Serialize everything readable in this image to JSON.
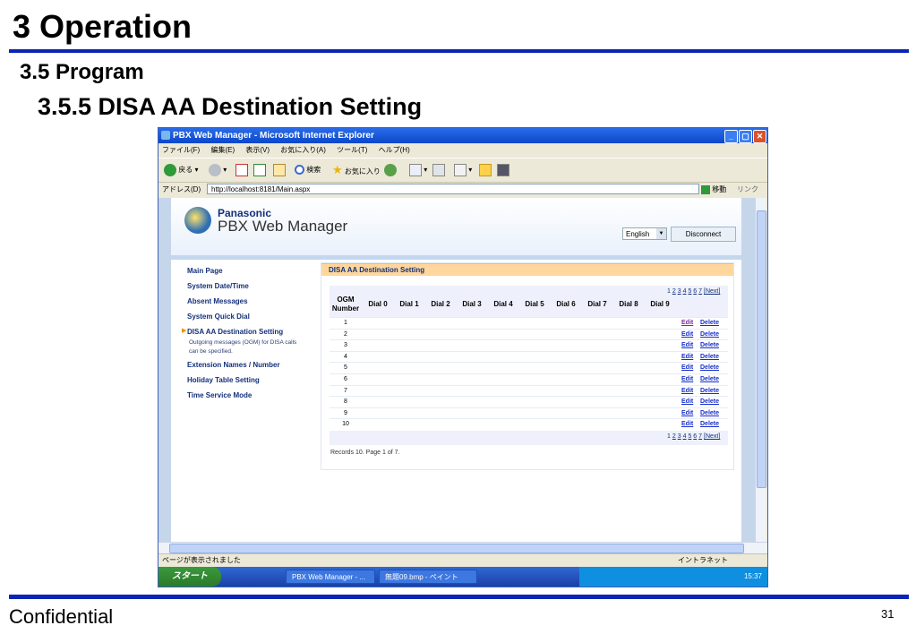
{
  "slide": {
    "title": "3 Operation",
    "subtitle1": "3.5 Program",
    "subtitle2": "3.5.5 DISA AA Destination Setting",
    "footer_left": "Confidential",
    "page_number": "31"
  },
  "browser": {
    "window_title": "PBX Web Manager - Microsoft Internet Explorer",
    "menu": [
      "ファイル(F)",
      "編集(E)",
      "表示(V)",
      "お気に入り(A)",
      "ツール(T)",
      "ヘルプ(H)"
    ],
    "toolbar": {
      "back": "戻る",
      "search": "検索",
      "favorites": "お気に入り"
    },
    "address_label": "アドレス(D)",
    "url": "http://localhost:8181/Main.aspx",
    "go_label": "移動",
    "links_label": "リンク",
    "status_left": "ページが表示されました",
    "status_right": "イントラネット"
  },
  "taskbar": {
    "start": "スタート",
    "tasks": [
      "PBX Web Manager - ...",
      "無題09.bmp - ペイント"
    ],
    "clock": "15:37"
  },
  "app": {
    "brand": "Panasonic",
    "product": "PBX Web Manager",
    "language": "English",
    "disconnect": "Disconnect"
  },
  "sidebar": {
    "items": [
      {
        "label": "Main Page"
      },
      {
        "label": "System Date/Time"
      },
      {
        "label": "Absent Messages"
      },
      {
        "label": "System Quick Dial"
      },
      {
        "label": "DISA AA Destination Setting",
        "note": "Outgoing messages (OGM) for DISA calls can be specified."
      },
      {
        "label": "Extension Names / Number"
      },
      {
        "label": "Holiday Table Setting"
      },
      {
        "label": "Time Service Mode"
      }
    ]
  },
  "panel": {
    "title": "DISA AA Destination Setting",
    "pager_pages": [
      "1",
      "2",
      "3",
      "4",
      "5",
      "6",
      "7"
    ],
    "pager_next": "[Next]",
    "columns": [
      "OGM Number",
      "Dial 0",
      "Dial 1",
      "Dial 2",
      "Dial 3",
      "Dial 4",
      "Dial 5",
      "Dial 6",
      "Dial 7",
      "Dial 8",
      "Dial 9"
    ],
    "rows": [
      "1",
      "2",
      "3",
      "4",
      "5",
      "6",
      "7",
      "8",
      "9",
      "10"
    ],
    "edit_label": "Edit",
    "delete_label": "Delete",
    "records": "Records 10. Page 1 of 7."
  }
}
